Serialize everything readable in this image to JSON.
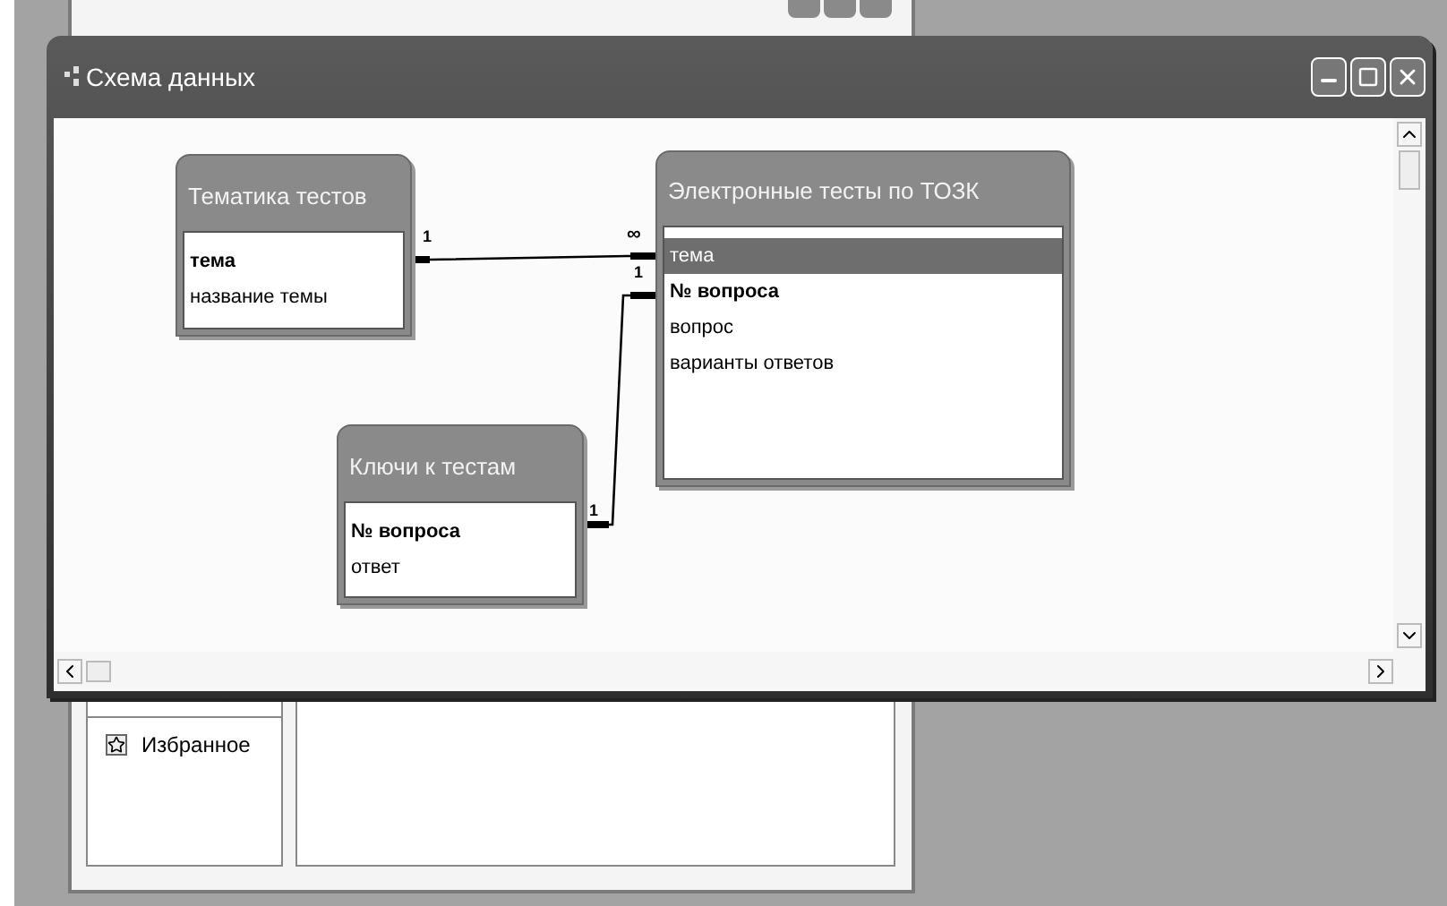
{
  "back_window": {
    "items": [
      {
        "label": "Избранное",
        "selected": false
      }
    ]
  },
  "window": {
    "title": "Схема данных"
  },
  "tables": [
    {
      "title": "Тематика тестов",
      "fields": [
        {
          "name": "тема",
          "key": true,
          "selected": false
        },
        {
          "name": "название темы",
          "key": false,
          "selected": false
        }
      ]
    },
    {
      "title": "Электронные тесты  по ТОЗК",
      "fields": [
        {
          "name": "тема",
          "key": false,
          "selected": true
        },
        {
          "name": "№ вопроса",
          "key": true,
          "selected": false
        },
        {
          "name": "вопрос",
          "key": false,
          "selected": false
        },
        {
          "name": "варианты ответов",
          "key": false,
          "selected": false
        }
      ]
    },
    {
      "title": "Ключи к тестам",
      "fields": [
        {
          "name": "№ вопроса",
          "key": true,
          "selected": false
        },
        {
          "name": "ответ",
          "key": false,
          "selected": false
        }
      ]
    }
  ],
  "relations": [
    {
      "from_label": "1",
      "to_label": "∞"
    },
    {
      "from_label": "1",
      "to_label": "1"
    }
  ]
}
